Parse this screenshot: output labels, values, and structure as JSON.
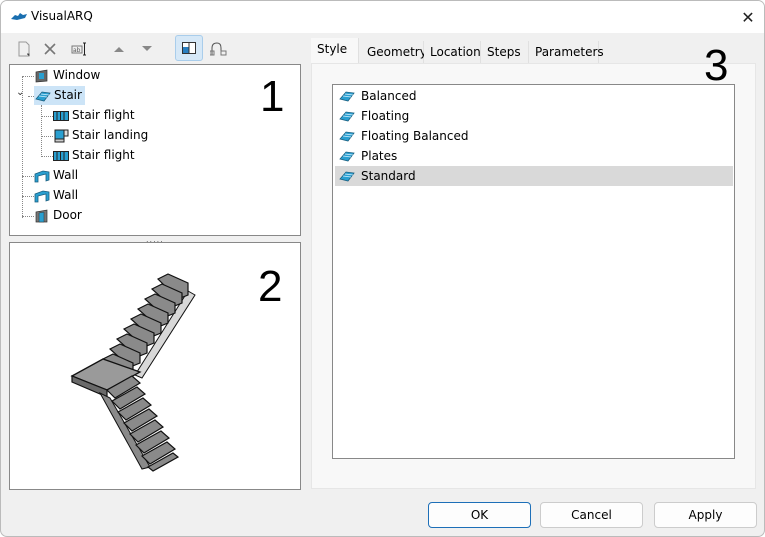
{
  "window": {
    "title": "VisualARQ",
    "close_label": "✕"
  },
  "toolbar": {
    "buttons": [
      {
        "name": "new-icon",
        "glyph": "🗋"
      },
      {
        "name": "delete-icon",
        "glyph": "✕"
      },
      {
        "name": "rename-icon",
        "glyph": "ab|"
      },
      {
        "name": "move-up-icon",
        "glyph": "▲"
      },
      {
        "name": "move-down-icon",
        "glyph": "▼"
      },
      {
        "name": "preview-toggle-icon",
        "glyph": "▤",
        "active": true
      },
      {
        "name": "profile-icon",
        "glyph": "⎍"
      }
    ]
  },
  "tree": {
    "items": [
      {
        "label": "Window",
        "icon": "window-icon",
        "level": 0
      },
      {
        "label": "Stair",
        "icon": "stair-icon",
        "level": 0,
        "expanded": true,
        "selected": true
      },
      {
        "label": "Stair flight",
        "icon": "stair-flight-icon",
        "level": 1
      },
      {
        "label": "Stair landing",
        "icon": "stair-landing-icon",
        "level": 1
      },
      {
        "label": "Stair flight",
        "icon": "stair-flight-icon",
        "level": 1
      },
      {
        "label": "Wall",
        "icon": "wall-icon",
        "level": 0
      },
      {
        "label": "Wall",
        "icon": "wall-icon",
        "level": 0
      },
      {
        "label": "Door",
        "icon": "door-icon",
        "level": 0
      }
    ]
  },
  "annotations": {
    "one": "1",
    "two": "2",
    "three": "3"
  },
  "splitter": ".....",
  "tabs": [
    {
      "label": "Style",
      "active": true
    },
    {
      "label": "Geometry"
    },
    {
      "label": "Location"
    },
    {
      "label": "Steps"
    },
    {
      "label": "Parameters"
    }
  ],
  "styles": {
    "items": [
      {
        "label": "Balanced"
      },
      {
        "label": "Floating"
      },
      {
        "label": "Floating Balanced"
      },
      {
        "label": "Plates"
      },
      {
        "label": "Standard",
        "selected": true
      }
    ]
  },
  "buttons": {
    "ok": "OK",
    "cancel": "Cancel",
    "apply": "Apply"
  },
  "colors": {
    "accent": "#1d6fb8",
    "selection": "#cce4f7",
    "icon_blue": "#2a9fd0"
  }
}
